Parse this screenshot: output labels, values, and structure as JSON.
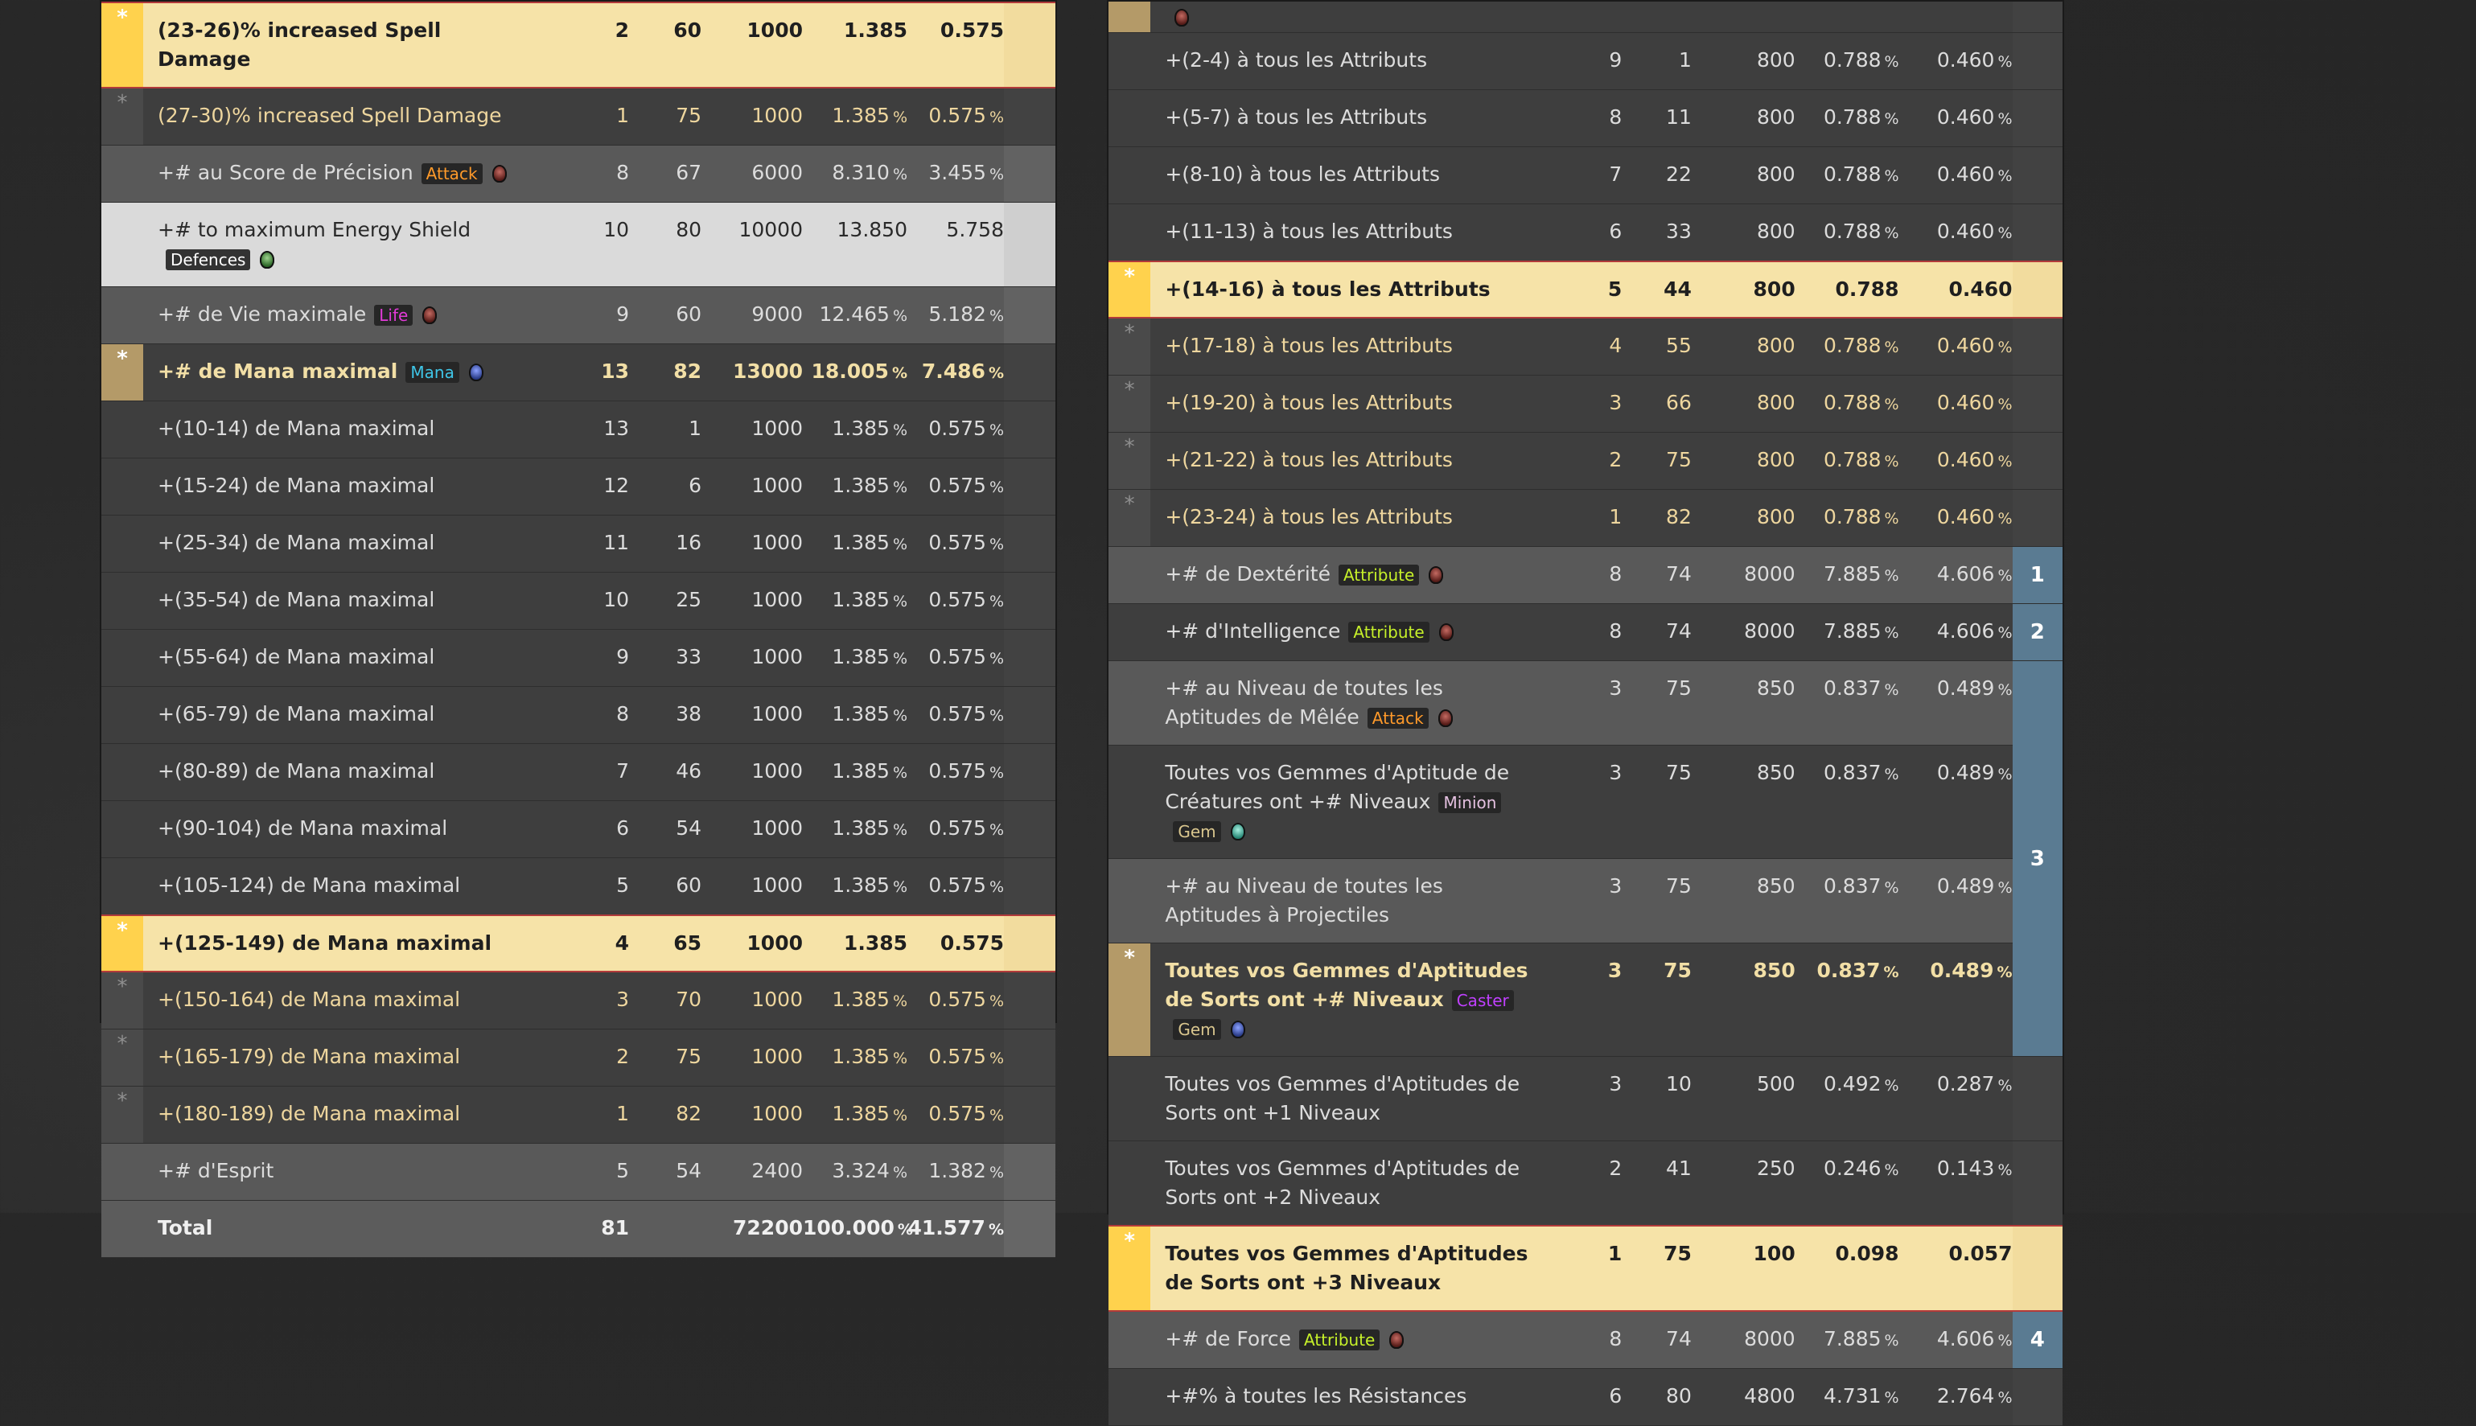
{
  "left_table": {
    "rows": [
      {
        "kind": "h",
        "marker": "*",
        "name": "(23-26)% increased Spell Damage",
        "tags": [],
        "icon": "",
        "level": "2",
        "ilvl": "60",
        "weight": "1000",
        "pct1": "1.385",
        "pct2": "0.575",
        "pct_units": false
      },
      {
        "kind": "s",
        "marker": "*",
        "name": "(27-30)% increased Spell Damage",
        "tags": [],
        "icon": "",
        "level": "1",
        "ilvl": "75",
        "weight": "1000",
        "pct1": "1.385",
        "pct2": "0.575",
        "pct_units": true
      },
      {
        "kind": "g",
        "name": "+# au Score de Précision",
        "tags": [
          {
            "label": "Attack",
            "cls": "attack"
          }
        ],
        "icon": "red",
        "level": "8",
        "ilvl": "67",
        "weight": "6000",
        "pct1": "8.310",
        "pct2": "3.455",
        "pct_units": true
      },
      {
        "kind": "w",
        "name": "+# to maximum Energy Shield",
        "tags": [
          {
            "label": "Defences",
            "cls": "defences"
          }
        ],
        "icon": "green",
        "level": "10",
        "ilvl": "80",
        "weight": "10000",
        "pct1": "13.850",
        "pct2": "5.758",
        "pct_units": false
      },
      {
        "kind": "g",
        "name": "+# de Vie maximale",
        "tags": [
          {
            "label": "Life",
            "cls": "life"
          }
        ],
        "icon": "red",
        "level": "9",
        "ilvl": "60",
        "weight": "9000",
        "pct1": "12.465",
        "pct2": "5.182",
        "pct_units": true
      },
      {
        "kind": "tb",
        "marker": "*",
        "name": "+# de Mana maximal",
        "tags": [
          {
            "label": "Mana",
            "cls": "mana"
          }
        ],
        "icon": "blue",
        "level": "13",
        "ilvl": "82",
        "weight": "13000",
        "pct1": "18.005",
        "pct2": "7.486",
        "pct_units": true
      },
      {
        "kind": "n",
        "name": "+(10-14) de Mana maximal",
        "tags": [],
        "icon": "",
        "level": "13",
        "ilvl": "1",
        "weight": "1000",
        "pct1": "1.385",
        "pct2": "0.575",
        "pct_units": true
      },
      {
        "kind": "n",
        "name": "+(15-24) de Mana maximal",
        "tags": [],
        "icon": "",
        "level": "12",
        "ilvl": "6",
        "weight": "1000",
        "pct1": "1.385",
        "pct2": "0.575",
        "pct_units": true
      },
      {
        "kind": "n",
        "name": "+(25-34) de Mana maximal",
        "tags": [],
        "icon": "",
        "level": "11",
        "ilvl": "16",
        "weight": "1000",
        "pct1": "1.385",
        "pct2": "0.575",
        "pct_units": true
      },
      {
        "kind": "n",
        "name": "+(35-54) de Mana maximal",
        "tags": [],
        "icon": "",
        "level": "10",
        "ilvl": "25",
        "weight": "1000",
        "pct1": "1.385",
        "pct2": "0.575",
        "pct_units": true
      },
      {
        "kind": "n",
        "name": "+(55-64) de Mana maximal",
        "tags": [],
        "icon": "",
        "level": "9",
        "ilvl": "33",
        "weight": "1000",
        "pct1": "1.385",
        "pct2": "0.575",
        "pct_units": true
      },
      {
        "kind": "n",
        "name": "+(65-79) de Mana maximal",
        "tags": [],
        "icon": "",
        "level": "8",
        "ilvl": "38",
        "weight": "1000",
        "pct1": "1.385",
        "pct2": "0.575",
        "pct_units": true
      },
      {
        "kind": "n",
        "name": "+(80-89) de Mana maximal",
        "tags": [],
        "icon": "",
        "level": "7",
        "ilvl": "46",
        "weight": "1000",
        "pct1": "1.385",
        "pct2": "0.575",
        "pct_units": true
      },
      {
        "kind": "n",
        "name": "+(90-104) de Mana maximal",
        "tags": [],
        "icon": "",
        "level": "6",
        "ilvl": "54",
        "weight": "1000",
        "pct1": "1.385",
        "pct2": "0.575",
        "pct_units": true
      },
      {
        "kind": "n",
        "name": "+(105-124) de Mana maximal",
        "tags": [],
        "icon": "",
        "level": "5",
        "ilvl": "60",
        "weight": "1000",
        "pct1": "1.385",
        "pct2": "0.575",
        "pct_units": true
      },
      {
        "kind": "h",
        "marker": "*",
        "name": "+(125-149) de Mana maximal",
        "tags": [],
        "icon": "",
        "level": "4",
        "ilvl": "65",
        "weight": "1000",
        "pct1": "1.385",
        "pct2": "0.575",
        "pct_units": false
      },
      {
        "kind": "s",
        "marker": "*",
        "name": "+(150-164) de Mana maximal",
        "tags": [],
        "icon": "",
        "level": "3",
        "ilvl": "70",
        "weight": "1000",
        "pct1": "1.385",
        "pct2": "0.575",
        "pct_units": true
      },
      {
        "kind": "s",
        "marker": "*",
        "name": "+(165-179) de Mana maximal",
        "tags": [],
        "icon": "",
        "level": "2",
        "ilvl": "75",
        "weight": "1000",
        "pct1": "1.385",
        "pct2": "0.575",
        "pct_units": true
      },
      {
        "kind": "s",
        "marker": "*",
        "name": "+(180-189) de Mana maximal",
        "tags": [],
        "icon": "",
        "level": "1",
        "ilvl": "82",
        "weight": "1000",
        "pct1": "1.385",
        "pct2": "0.575",
        "pct_units": true
      },
      {
        "kind": "g",
        "name": "+# d'Esprit",
        "tags": [],
        "icon": "",
        "level": "5",
        "ilvl": "54",
        "weight": "2400",
        "pct1": "3.324",
        "pct2": "1.382",
        "pct_units": true
      },
      {
        "kind": "t",
        "name": "Total",
        "tags": [],
        "icon": "",
        "level": "81",
        "ilvl": "",
        "weight": "72200",
        "pct1": "100.000",
        "pct2": "41.577",
        "pct_units": true
      }
    ]
  },
  "right_table": {
    "rows": [
      {
        "kind": "tb",
        "marker": "",
        "name": "",
        "tags": [],
        "icon": "red",
        "level": "",
        "ilvl": "",
        "weight": "",
        "pct1": "",
        "pct2": "",
        "pct_units": false,
        "group": "",
        "stub": true
      },
      {
        "kind": "n",
        "name": "+(2-4) à tous les Attributs",
        "tags": [],
        "icon": "",
        "level": "9",
        "ilvl": "1",
        "weight": "800",
        "pct1": "0.788",
        "pct2": "0.460",
        "pct_units": true,
        "group": ""
      },
      {
        "kind": "n",
        "name": "+(5-7) à tous les Attributs",
        "tags": [],
        "icon": "",
        "level": "8",
        "ilvl": "11",
        "weight": "800",
        "pct1": "0.788",
        "pct2": "0.460",
        "pct_units": true,
        "group": ""
      },
      {
        "kind": "n",
        "name": "+(8-10) à tous les Attributs",
        "tags": [],
        "icon": "",
        "level": "7",
        "ilvl": "22",
        "weight": "800",
        "pct1": "0.788",
        "pct2": "0.460",
        "pct_units": true,
        "group": ""
      },
      {
        "kind": "n",
        "name": "+(11-13) à tous les Attributs",
        "tags": [],
        "icon": "",
        "level": "6",
        "ilvl": "33",
        "weight": "800",
        "pct1": "0.788",
        "pct2": "0.460",
        "pct_units": true,
        "group": ""
      },
      {
        "kind": "h",
        "marker": "*",
        "name": "+(14-16) à tous les Attributs",
        "tags": [],
        "icon": "",
        "level": "5",
        "ilvl": "44",
        "weight": "800",
        "pct1": "0.788",
        "pct2": "0.460",
        "pct_units": false,
        "group": ""
      },
      {
        "kind": "s",
        "marker": "*",
        "name": "+(17-18) à tous les Attributs",
        "tags": [],
        "icon": "",
        "level": "4",
        "ilvl": "55",
        "weight": "800",
        "pct1": "0.788",
        "pct2": "0.460",
        "pct_units": true,
        "group": ""
      },
      {
        "kind": "s",
        "marker": "*",
        "name": "+(19-20) à tous les Attributs",
        "tags": [],
        "icon": "",
        "level": "3",
        "ilvl": "66",
        "weight": "800",
        "pct1": "0.788",
        "pct2": "0.460",
        "pct_units": true,
        "group": ""
      },
      {
        "kind": "s",
        "marker": "*",
        "name": "+(21-22) à tous les Attributs",
        "tags": [],
        "icon": "",
        "level": "2",
        "ilvl": "75",
        "weight": "800",
        "pct1": "0.788",
        "pct2": "0.460",
        "pct_units": true,
        "group": ""
      },
      {
        "kind": "s",
        "marker": "*",
        "name": "+(23-24) à tous les Attributs",
        "tags": [],
        "icon": "",
        "level": "1",
        "ilvl": "82",
        "weight": "800",
        "pct1": "0.788",
        "pct2": "0.460",
        "pct_units": true,
        "group": ""
      },
      {
        "kind": "g",
        "name": "+# de Dextérité",
        "tags": [
          {
            "label": "Attribute",
            "cls": "attribute"
          }
        ],
        "icon": "red",
        "level": "8",
        "ilvl": "74",
        "weight": "8000",
        "pct1": "7.885",
        "pct2": "4.606",
        "pct_units": true,
        "group": "1"
      },
      {
        "kind": "n",
        "name": "+# d'Intelligence",
        "tags": [
          {
            "label": "Attribute",
            "cls": "attribute"
          }
        ],
        "icon": "red",
        "level": "8",
        "ilvl": "74",
        "weight": "8000",
        "pct1": "7.885",
        "pct2": "4.606",
        "pct_units": true,
        "group": "2"
      },
      {
        "kind": "g",
        "name": "+# au Niveau de toutes les Aptitudes de Mêlée",
        "tags": [
          {
            "label": "Attack",
            "cls": "attack"
          }
        ],
        "icon": "red",
        "level": "3",
        "ilvl": "75",
        "weight": "850",
        "pct1": "0.837",
        "pct2": "0.489",
        "pct_units": true,
        "group": "3"
      },
      {
        "kind": "n",
        "name": "Toutes vos Gemmes d'Aptitude de Créatures ont +# Niveaux",
        "tags": [
          {
            "label": "Minion",
            "cls": "minion"
          },
          {
            "label": "Gem",
            "cls": "gem"
          }
        ],
        "icon": "teal",
        "level": "3",
        "ilvl": "75",
        "weight": "850",
        "pct1": "0.837",
        "pct2": "0.489",
        "pct_units": true,
        "group": "3"
      },
      {
        "kind": "g",
        "name": "+# au Niveau de toutes les Aptitudes à Projectiles",
        "tags": [],
        "icon": "",
        "level": "3",
        "ilvl": "75",
        "weight": "850",
        "pct1": "0.837",
        "pct2": "0.489",
        "pct_units": true,
        "group": "3"
      },
      {
        "kind": "tb",
        "marker": "*",
        "name": "Toutes vos Gemmes d'Aptitudes de Sorts ont +# Niveaux",
        "tags": [
          {
            "label": "Caster",
            "cls": "caster"
          },
          {
            "label": "Gem",
            "cls": "gem"
          }
        ],
        "icon": "blue",
        "level": "3",
        "ilvl": "75",
        "weight": "850",
        "pct1": "0.837",
        "pct2": "0.489",
        "pct_units": true,
        "group": "3"
      },
      {
        "kind": "n",
        "name": "Toutes vos Gemmes d'Aptitudes de Sorts ont +1 Niveaux",
        "tags": [],
        "icon": "",
        "level": "3",
        "ilvl": "10",
        "weight": "500",
        "pct1": "0.492",
        "pct2": "0.287",
        "pct_units": true,
        "group": ""
      },
      {
        "kind": "n",
        "name": "Toutes vos Gemmes d'Aptitudes de Sorts ont +2 Niveaux",
        "tags": [],
        "icon": "",
        "level": "2",
        "ilvl": "41",
        "weight": "250",
        "pct1": "0.246",
        "pct2": "0.143",
        "pct_units": true,
        "group": ""
      },
      {
        "kind": "h",
        "marker": "*",
        "name": "Toutes vos Gemmes d'Aptitudes de Sorts ont +3 Niveaux",
        "tags": [],
        "icon": "",
        "level": "1",
        "ilvl": "75",
        "weight": "100",
        "pct1": "0.098",
        "pct2": "0.057",
        "pct_units": false,
        "group": ""
      },
      {
        "kind": "g",
        "name": "+# de Force",
        "tags": [
          {
            "label": "Attribute",
            "cls": "attribute"
          }
        ],
        "icon": "red",
        "level": "8",
        "ilvl": "74",
        "weight": "8000",
        "pct1": "7.885",
        "pct2": "4.606",
        "pct_units": true,
        "group": "4"
      },
      {
        "kind": "n",
        "name": "+#% à toutes les Résistances",
        "tags": [],
        "icon": "",
        "level": "6",
        "ilvl": "80",
        "weight": "4800",
        "pct1": "4.731",
        "pct2": "2.764",
        "pct_units": true,
        "group": ""
      }
    ]
  },
  "pct_unit_symbol": "%"
}
